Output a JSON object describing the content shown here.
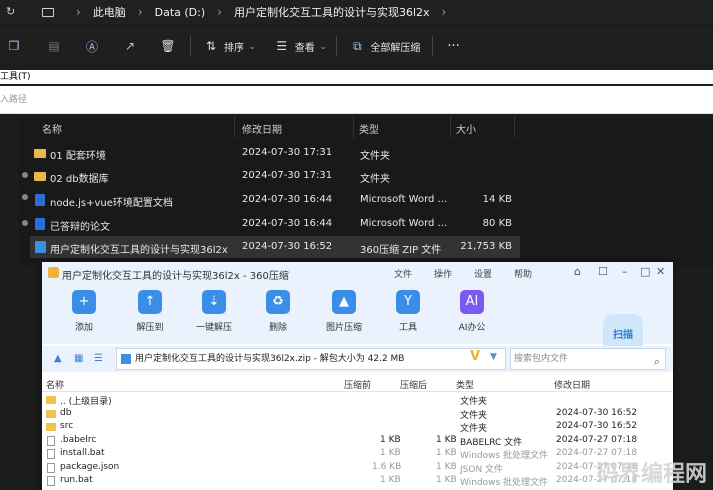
{
  "explorer": {
    "breadcrumb": [
      "此电脑",
      "Data (D:)",
      "用户定制化交互工具的设计与实现36l2x"
    ],
    "toolbar": {
      "sort_label": "排序",
      "view_label": "查看",
      "extract_all_label": "全部解压缩",
      "more": "···"
    },
    "menu_text": "工具(T)",
    "path_placeholder": "入路径",
    "columns": [
      "名称",
      "修改日期",
      "类型",
      "大小"
    ],
    "rows": [
      {
        "name": "01 配套环境",
        "date": "2024-07-30 17:31",
        "type": "文件夹",
        "size": ""
      },
      {
        "name": "02 db数据库",
        "date": "2024-07-30 17:31",
        "type": "文件夹",
        "size": ""
      },
      {
        "name": "node.js+vue环境配置文档",
        "date": "2024-07-30 16:44",
        "type": "Microsoft Word ...",
        "size": "14 KB"
      },
      {
        "name": "已答辩的论文",
        "date": "2024-07-30 16:44",
        "type": "Microsoft Word ...",
        "size": "80 KB"
      },
      {
        "name": "用户定制化交互工具的设计与实现36l2x",
        "date": "2024-07-30 16:52",
        "type": "360压缩 ZIP 文件",
        "size": "21,753 KB"
      }
    ]
  },
  "zip_window": {
    "title": "用户定制化交互工具的设计与实现36l2x - 360压缩",
    "menu": [
      "文件",
      "操作",
      "设置",
      "帮助"
    ],
    "tools": [
      "添加",
      "解压到",
      "一键解压",
      "删除",
      "图片压缩",
      "工具",
      "AI办公"
    ],
    "scan_label": "扫描",
    "address": "用户定制化交互工具的设计与实现36l2x.zip - 解包大小为 42.2 MB",
    "search_placeholder": "搜索包内文件",
    "columns": [
      "名称",
      "压缩前",
      "压缩后",
      "类型",
      "修改日期"
    ],
    "rows": [
      {
        "name": ".. (上级目录)",
        "before": "",
        "after": "",
        "type": "文件夹",
        "date": ""
      },
      {
        "name": "db",
        "before": "",
        "after": "",
        "type": "文件夹",
        "date": "2024-07-30 16:52"
      },
      {
        "name": "src",
        "before": "",
        "after": "",
        "type": "文件夹",
        "date": "2024-07-30 16:52"
      },
      {
        "name": ".babelrc",
        "before": "1 KB",
        "after": "1 KB",
        "type": "BABELRC 文件",
        "date": "2024-07-27 07:18"
      },
      {
        "name": "install.bat",
        "before": "1 KB",
        "after": "1 KB",
        "type": "Windows 批处理文件",
        "date": "2024-07-27 07:18"
      },
      {
        "name": "package.json",
        "before": "1.6 KB",
        "after": "1 KB",
        "type": "JSON 文件",
        "date": "2024-07-27 07:18"
      },
      {
        "name": "run.bat",
        "before": "1 KB",
        "after": "1 KB",
        "type": "Windows 批处理文件",
        "date": "2024-07-27 07:18"
      }
    ]
  },
  "watermark": "码界编程网"
}
